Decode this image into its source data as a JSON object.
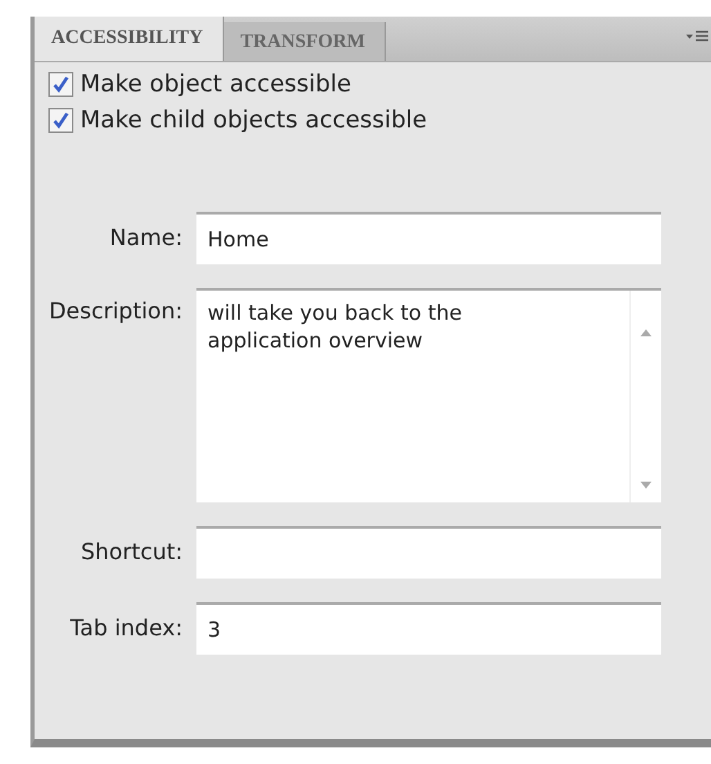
{
  "tabs": [
    {
      "label": "ACCESSIBILITY",
      "selected": true
    },
    {
      "label": "TRANSFORM",
      "selected": false
    }
  ],
  "checkboxes": [
    {
      "label": "Make object accessible",
      "checked": true
    },
    {
      "label": "Make child objects accessible",
      "checked": true
    }
  ],
  "fields": [
    {
      "kind": "text",
      "label": "Name:",
      "value": "Home"
    },
    {
      "kind": "textarea",
      "label": "Description:",
      "value": "will take you back to the application overview"
    },
    {
      "kind": "text",
      "label": "Shortcut:"
    },
    {
      "kind": "text",
      "label": "Tab index:",
      "value": "3"
    }
  ]
}
